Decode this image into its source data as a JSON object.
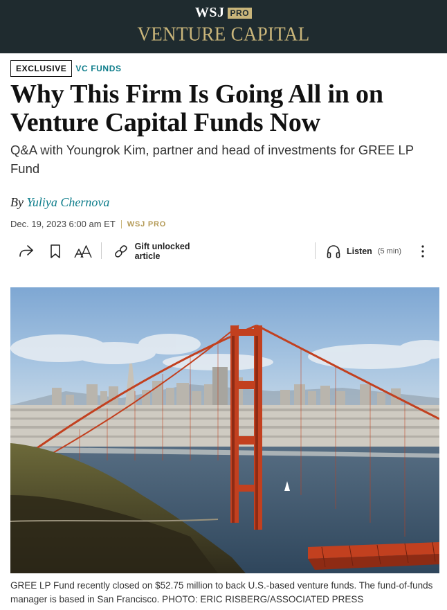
{
  "masthead": {
    "brand": "WSJ",
    "pro_badge": "PRO",
    "section": "VENTURE CAPITAL"
  },
  "article": {
    "tag_primary": "EXCLUSIVE",
    "tag_section": "VC FUNDS",
    "headline_line1": "Why This Firm Is Going All in on",
    "headline_line2": "Venture Capital Funds Now",
    "dek": "Q&A with Youngrok Kim, partner and head of investments for GREE LP Fund",
    "byline_prefix": "By",
    "author": "Yuliya Chernova",
    "date": "Dec. 19, 2023 6:00 am ET",
    "pro_label": "WSJ PRO"
  },
  "toolbar": {
    "share_icon": "share-icon",
    "bookmark_icon": "bookmark-icon",
    "text_size_icon": "text-size-icon",
    "gift_label": "Gift unlocked article",
    "listen_label": "Listen",
    "listen_duration": "(5 min)",
    "more_icon": "more-vertical-icon"
  },
  "photo": {
    "caption": "GREE LP Fund recently closed on $52.75 million to back U.S.-based venture funds. The fund-of-funds manager is based in San Francisco.  PHOTO: ERIC RISBERG/ASSOCIATED PRESS"
  },
  "colors": {
    "masthead_bg": "#1f2b2f",
    "gold": "#c9b57a",
    "teal": "#0c7c8a",
    "bridge": "#c2401f"
  }
}
